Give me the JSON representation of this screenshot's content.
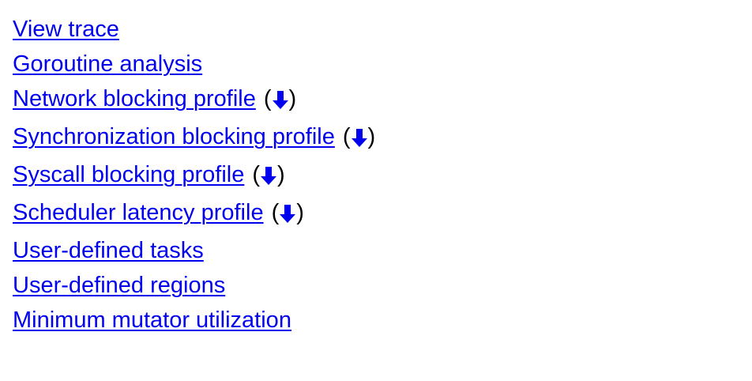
{
  "links": [
    {
      "label": "View trace",
      "download": false
    },
    {
      "label": "Goroutine analysis",
      "download": false
    },
    {
      "label": "Network blocking profile",
      "download": true
    },
    {
      "label": "Synchronization blocking profile",
      "download": true
    },
    {
      "label": "Syscall blocking profile",
      "download": true
    },
    {
      "label": "Scheduler latency profile",
      "download": true
    },
    {
      "label": "User-defined tasks",
      "download": false
    },
    {
      "label": "User-defined regions",
      "download": false
    },
    {
      "label": "Minimum mutator utilization",
      "download": false
    }
  ],
  "paren_open": "(",
  "paren_close": ")",
  "download_icon": "down-arrow-icon",
  "colors": {
    "link": "#0000ee",
    "text": "#000000",
    "background": "#ffffff"
  }
}
